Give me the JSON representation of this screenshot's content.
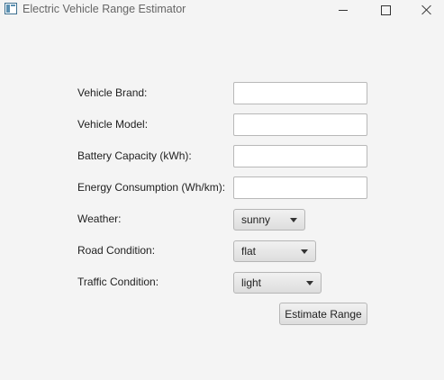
{
  "window": {
    "title": "Electric Vehicle Range Estimator",
    "icon": "app-window-icon",
    "controls": [
      "minimize-icon",
      "maximize-icon",
      "close-icon"
    ]
  },
  "form": {
    "vehicle_brand": {
      "label": "Vehicle Brand:",
      "value": ""
    },
    "vehicle_model": {
      "label": "Vehicle Model:",
      "value": ""
    },
    "battery_capacity": {
      "label": "Battery Capacity (kWh):",
      "value": ""
    },
    "energy_consumption": {
      "label": "Energy Consumption (Wh/km):",
      "value": ""
    },
    "weather": {
      "label": "Weather:",
      "selected": "sunny"
    },
    "road_condition": {
      "label": "Road Condition:",
      "selected": "flat"
    },
    "traffic_condition": {
      "label": "Traffic Condition:",
      "selected": "light"
    }
  },
  "actions": {
    "estimate_label": "Estimate Range"
  }
}
